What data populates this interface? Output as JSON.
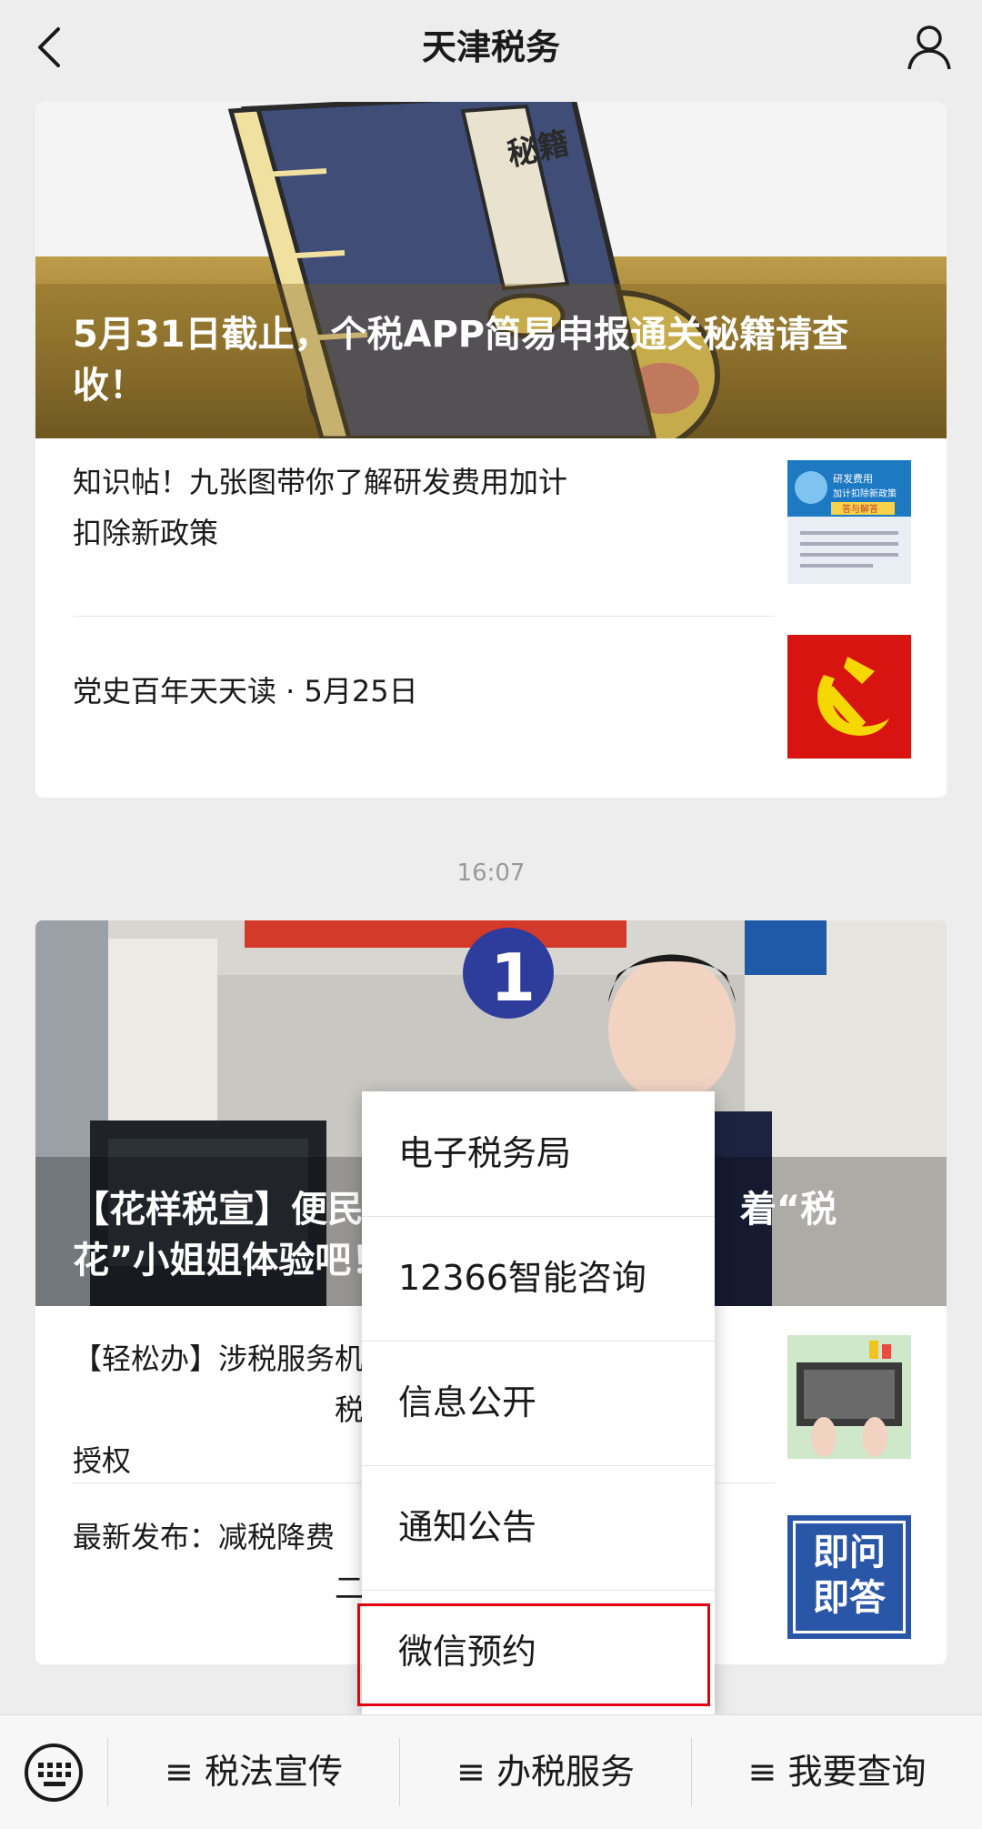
{
  "header": {
    "title": "天津税务"
  },
  "card1": {
    "hero_title": "5月31日截止，个税APP简易申报通关秘籍请查收！",
    "hero_book_text": "秘籍",
    "items": [
      {
        "text": "知识帖！九张图带你了解研发费用加计扣除新政策",
        "thumb_lines": [
          "研发费用",
          "加计扣除新政策",
          "答与解答"
        ]
      },
      {
        "text": "党史百年天天读 · 5月25日"
      }
    ]
  },
  "timestamp": "16:07",
  "card2": {
    "hero_title": "【花样税宣】便民办 　　　　　　　　　着“税花”小姐姐体验吧！",
    "hero_badge": "1",
    "items": [
      {
        "text": "【轻松办】涉税服务机 　　　　　　　　　税机构功能分配、授权 　　　　　　　　　…"
      },
      {
        "text": "最新发布：减税降费 　　　　　　　　　二期）（三）",
        "thumb_text": [
          "即问",
          "即答"
        ]
      }
    ]
  },
  "menu": {
    "items": [
      "电子税务局",
      "12366智能咨询",
      "信息公开",
      "通知公告",
      "微信预约"
    ]
  },
  "bottom_bar": {
    "tabs": [
      "≡ 税法宣传",
      "≡ 办税服务",
      "≡ 我要查询"
    ]
  },
  "colors": {
    "highlight": "#e3000f",
    "party_red": "#d7140f",
    "party_yellow": "#f5d800"
  },
  "icons": [
    "back-arrow-icon",
    "profile-icon",
    "keyboard-icon"
  ]
}
